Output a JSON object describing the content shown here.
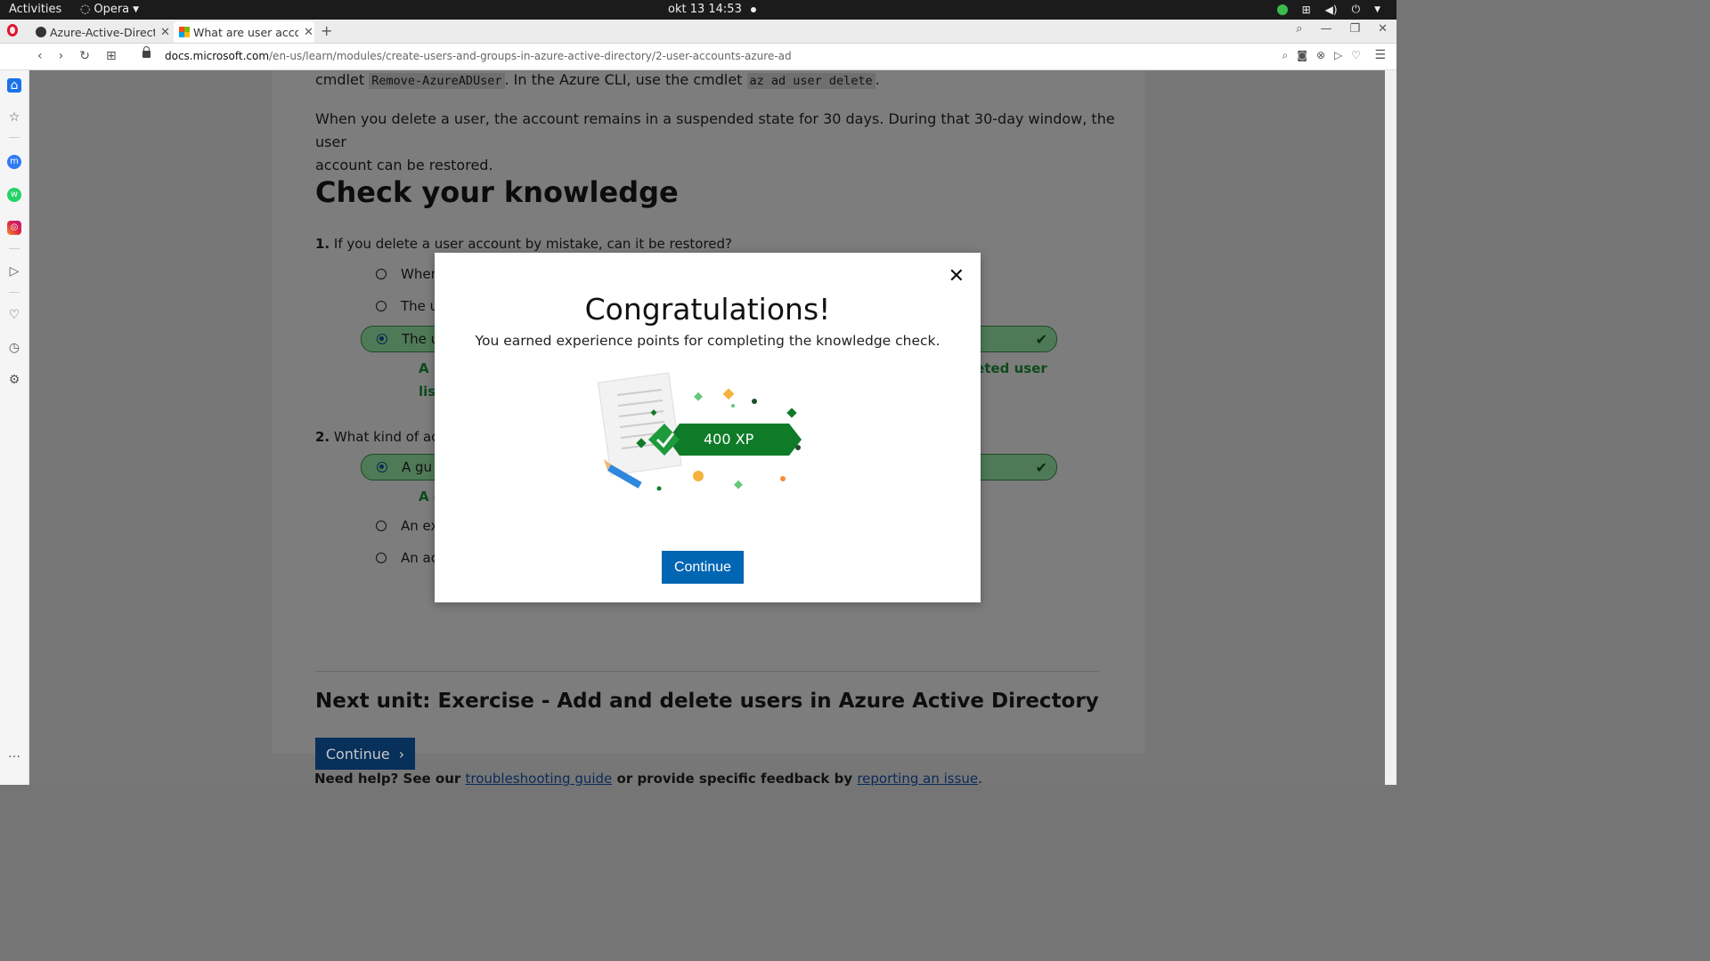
{
  "topbar": {
    "activities": "Activities",
    "app": "Opera",
    "clock": "okt 13  14:53"
  },
  "tabs": [
    {
      "title": "Azure-Active-Directo"
    },
    {
      "title": "What are user accoun"
    }
  ],
  "address": {
    "domain": "docs.microsoft.com",
    "path": "/en-us/learn/modules/create-users-and-groups-in-azure-active-directory/2-user-accounts-azure-ad"
  },
  "article": {
    "line1_pre": "cmdlet ",
    "line1_code1": "Remove-AzureADUser",
    "line1_mid": ". In the Azure CLI, use the cmdlet ",
    "line1_code2": "az ad user delete",
    "line1_post": ".",
    "para2_line1": "When you delete a user, the account remains in a suspended state for 30 days. During that 30-day window, the user",
    "para2_line2": "account can be restored.",
    "heading": "Check your knowledge",
    "q1_num": "1.",
    "q1_text": "If you delete a user account by mistake, can it be restored?",
    "q1_options": [
      "When",
      "The u",
      "The u"
    ],
    "q1_feedback_left1": "A u",
    "q1_feedback_left2": "list",
    "q1_feedback_right": "leted user",
    "q2_num": "2.",
    "q2_text": "What kind of acc",
    "q2_options": [
      "A gu",
      "An ex",
      "An ac"
    ],
    "q2_feedback": "A g",
    "next_unit": "Next unit: Exercise - Add and delete users in Azure Active Directory",
    "continue": "Continue",
    "help_pre": "Need help? See our ",
    "help_link1": "troubleshooting guide",
    "help_mid": " or provide specific feedback by ",
    "help_link2": "reporting an issue",
    "help_post": "."
  },
  "modal": {
    "close_glyph": "✕",
    "title": "Congratulations!",
    "subtitle": "You earned experience points for completing the knowledge check.",
    "xp": "400 XP",
    "continue": "Continue"
  }
}
